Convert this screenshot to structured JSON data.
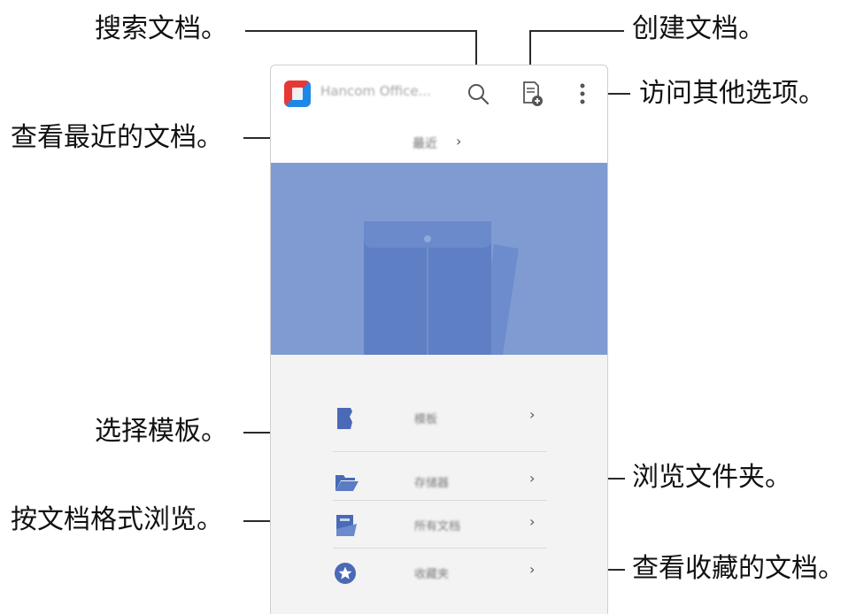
{
  "callouts": {
    "search": "搜索文档。",
    "create": "创建文档。",
    "more": "访问其他选项。",
    "recent": "查看最近的文档。",
    "templates": "选择模板。",
    "browse_folders": "浏览文件夹。",
    "browse_format": "按文档格式浏览。",
    "favorites": "查看收藏的文档。"
  },
  "app": {
    "title": "Hancom Office...",
    "recent_label": "最近",
    "chevron": "›"
  },
  "menu": [
    {
      "label": "模板",
      "icon": "template-icon"
    },
    {
      "label": "存储器",
      "icon": "folder-icon"
    },
    {
      "label": "所有文档",
      "icon": "documents-icon"
    },
    {
      "label": "收藏夹",
      "icon": "star-icon"
    }
  ],
  "colors": {
    "banner": "#7f9bd1",
    "accent": "#4a69b6",
    "menu_bg": "#f3f3f3"
  }
}
